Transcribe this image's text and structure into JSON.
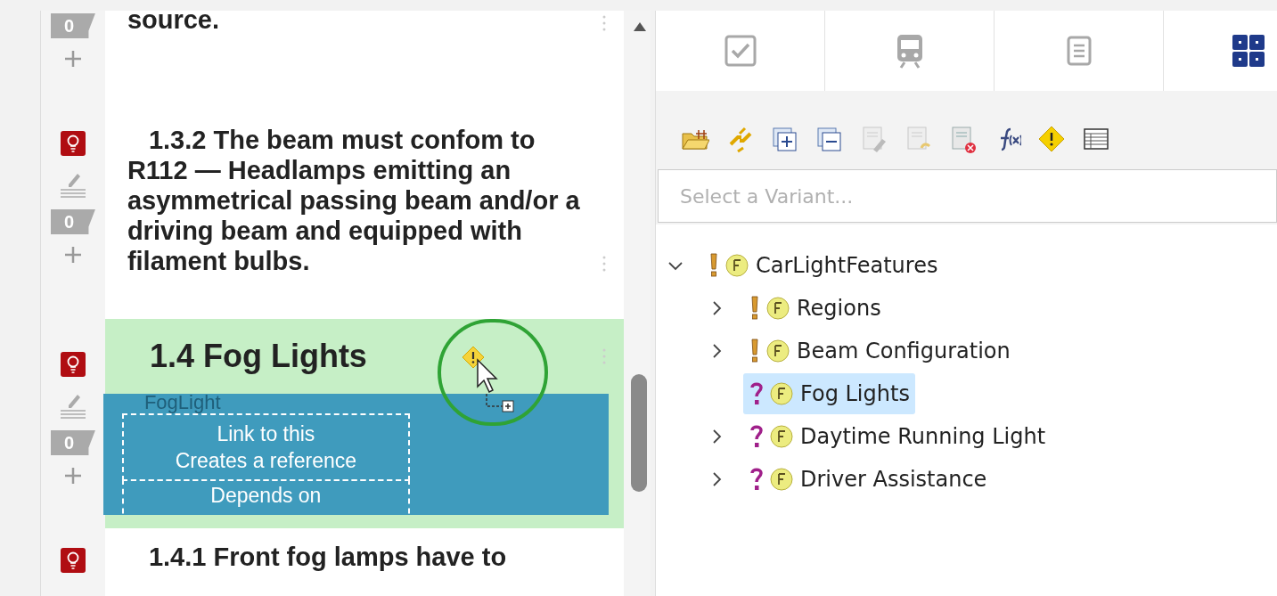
{
  "editor": {
    "blocks": [
      {
        "kind": "text",
        "text": "source.",
        "bulb": false,
        "pencil": false,
        "comments": "0",
        "highlighted": false,
        "warning": false
      },
      {
        "kind": "text",
        "text": "1.3.2 The beam must confom to R112 — Headlamps emitting an asymmetrical passing beam and/or a driving beam and equipped with filament bulbs.",
        "bulb": true,
        "pencil": true,
        "comments": "0",
        "highlighted": false,
        "warning": false
      },
      {
        "kind": "heading",
        "text": "1.4 Fog Lights",
        "bulb": true,
        "pencil": true,
        "comments": "0",
        "highlighted": true,
        "warning": true
      },
      {
        "kind": "text",
        "text": "1.4.1 Front fog lamps have to",
        "bulb": true,
        "pencil": false,
        "highlighted": false,
        "warning": false
      }
    ],
    "drop_overlay": {
      "ghost": "FogLight",
      "targets": [
        {
          "title": "Link to this",
          "subtitle": "Creates a reference"
        },
        {
          "title": "Depends on"
        }
      ]
    }
  },
  "tabs": [
    {
      "kind": "checkbox",
      "selected": false
    },
    {
      "kind": "train",
      "selected": false
    },
    {
      "kind": "document",
      "selected": false
    },
    {
      "kind": "grid",
      "selected": true
    }
  ],
  "variant_field": {
    "placeholder": "Select a Variant..."
  },
  "tree": [
    {
      "label": "CarLightFeatures",
      "kind": "mandatory",
      "expanded": true,
      "selected": false,
      "children": [
        {
          "label": "Regions",
          "kind": "mandatory",
          "expanded": false,
          "selected": false
        },
        {
          "label": "Beam Configuration",
          "kind": "mandatory",
          "expanded": false,
          "selected": false
        },
        {
          "label": "Fog Lights",
          "kind": "optional",
          "selected": true
        },
        {
          "label": "Daytime Running Light",
          "kind": "optional",
          "expanded": false,
          "selected": false
        },
        {
          "label": "Driver Assistance",
          "kind": "optional",
          "expanded": false,
          "selected": false
        }
      ]
    }
  ]
}
